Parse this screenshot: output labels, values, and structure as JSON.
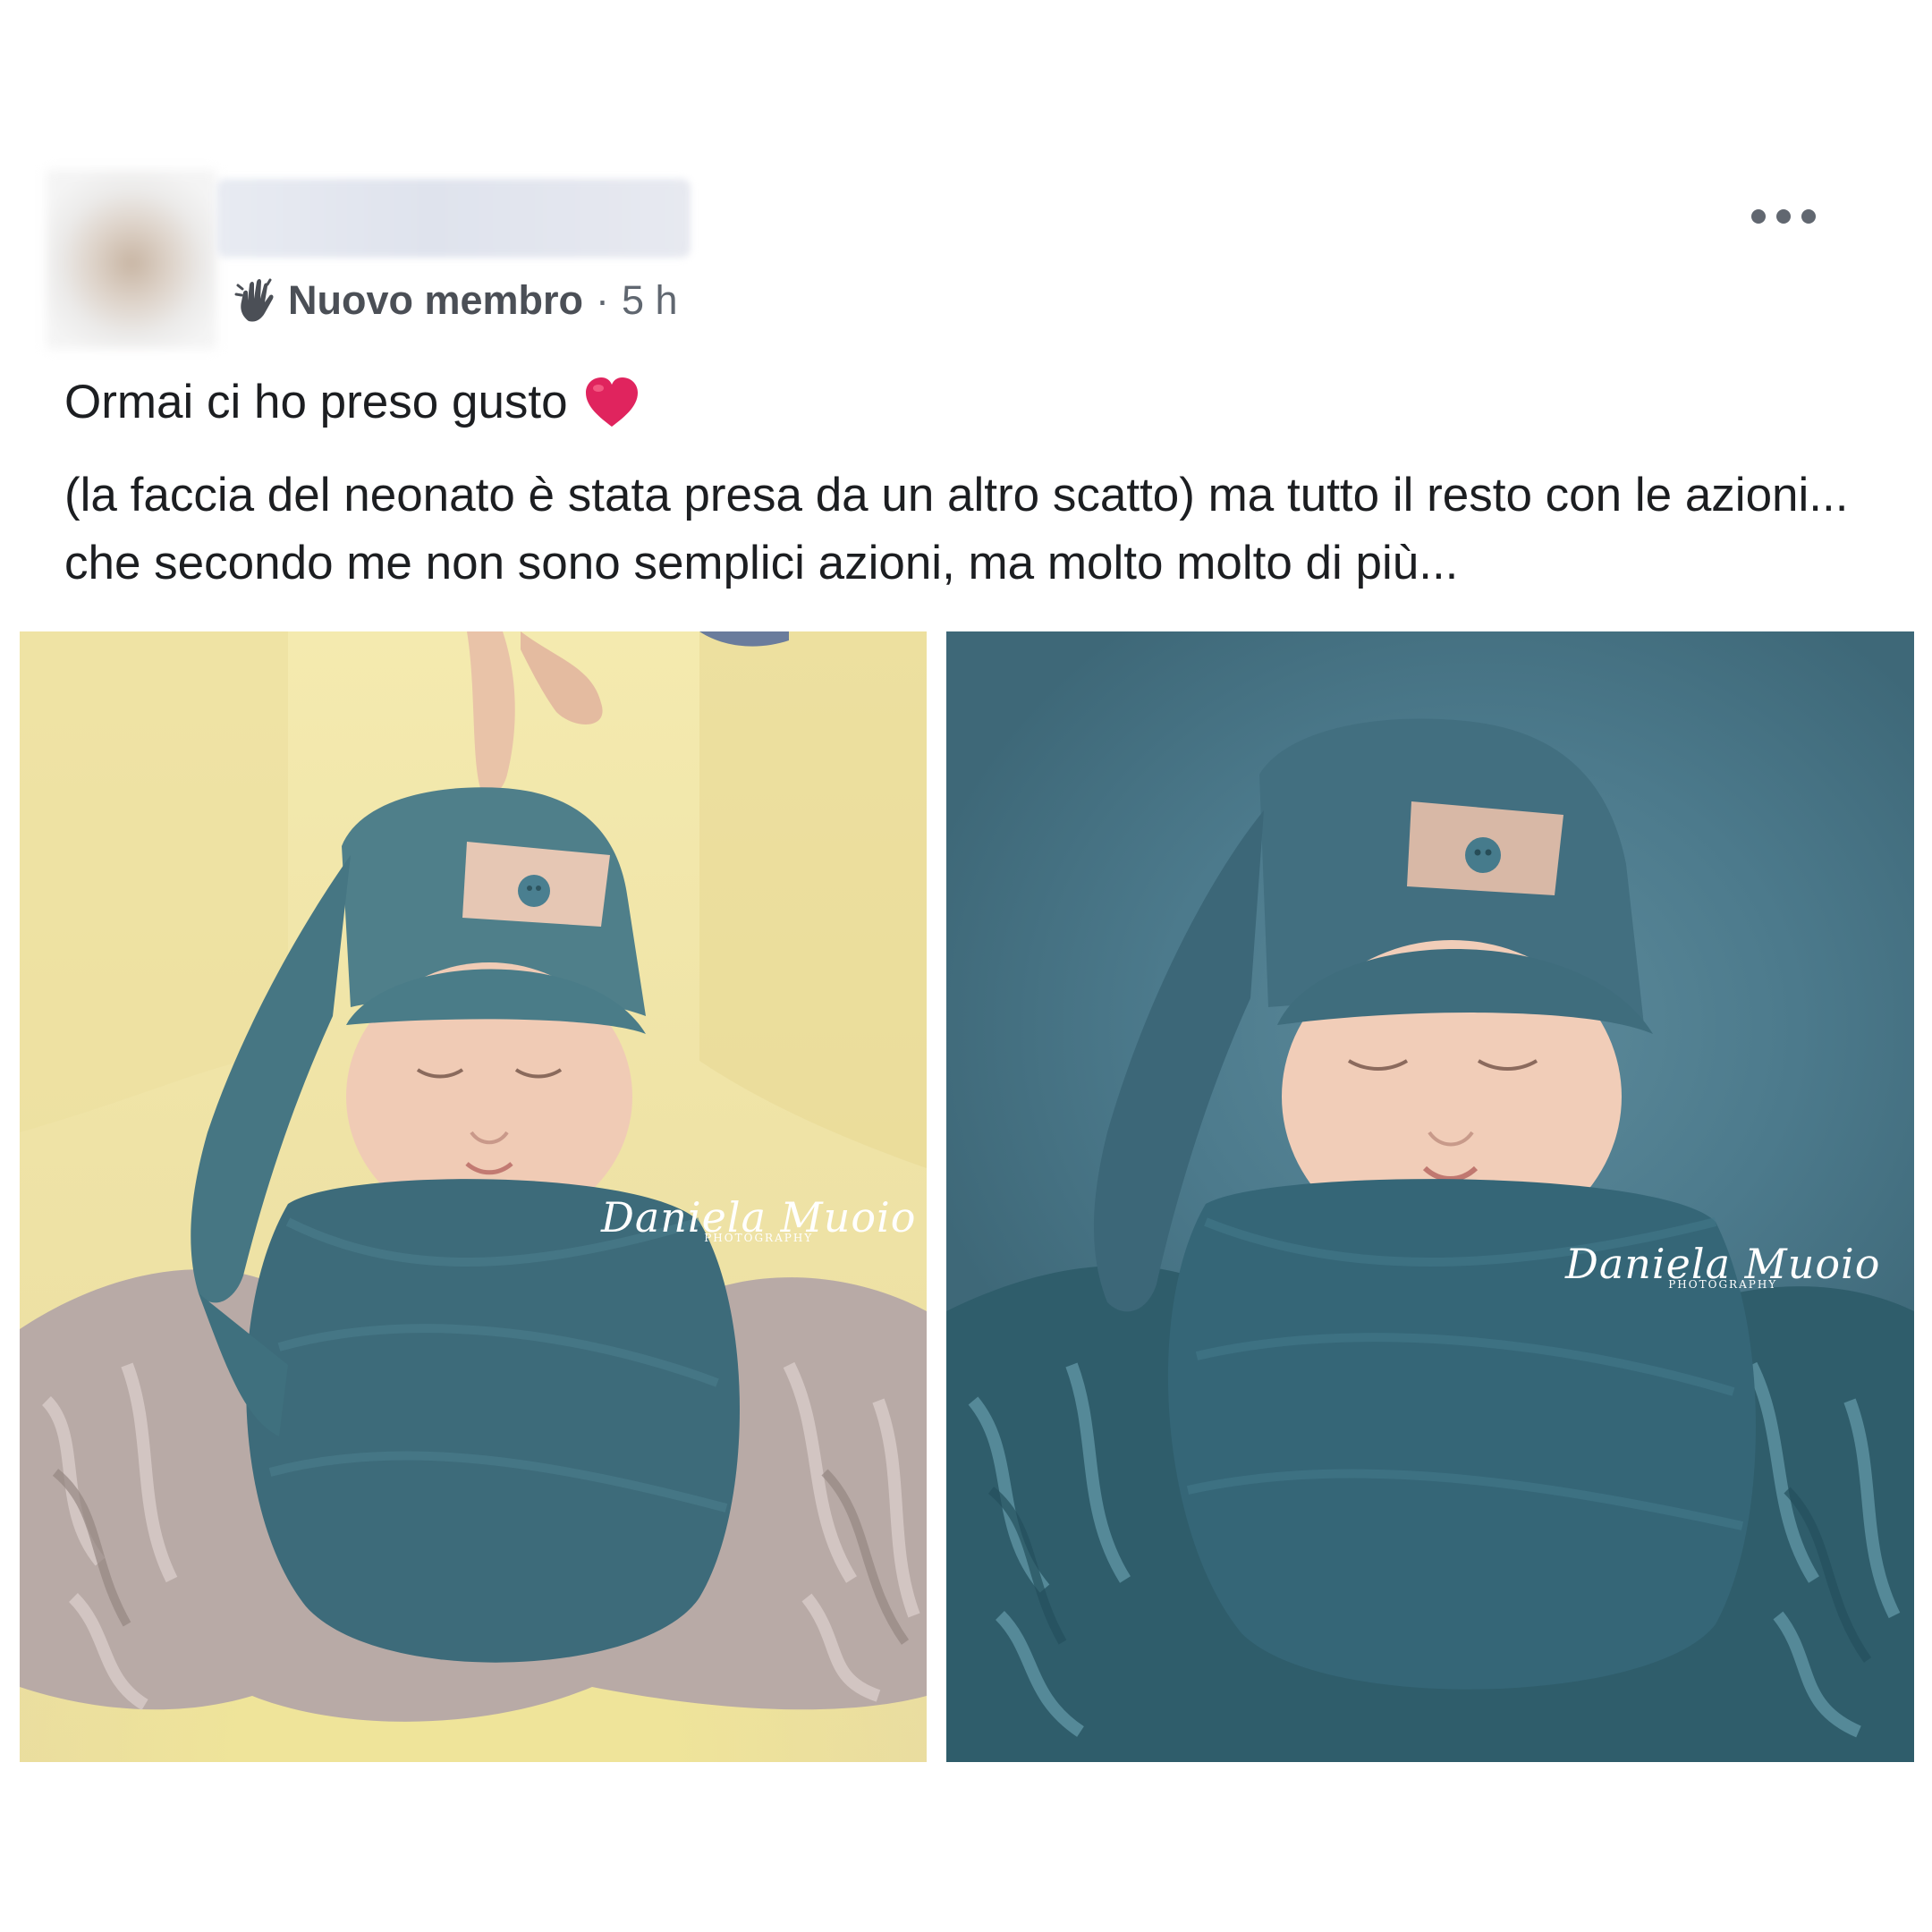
{
  "post": {
    "badge": "Nuovo membro",
    "separator": "·",
    "time": "5 h",
    "line1": "Ormai ci ho preso gusto",
    "body": "(la faccia del neonato è stata presa da un altro scatto) ma tutto il resto con le azioni... che secondo me non sono semplici azioni, ma molto molto di più..."
  },
  "watermark": {
    "script": "Daniela Muoio",
    "sub": "PHOTOGRAPHY"
  },
  "colors": {
    "text": "#1c1e21",
    "meta": "#606770",
    "heart": "#e0245e",
    "before_background": "#efe3a6",
    "after_background": "#4c7a8c",
    "swaddle": "#3f6f80"
  },
  "icons": {
    "badge": "new-member-hand-icon",
    "reaction": "heart-icon",
    "more": "ellipsis-icon"
  }
}
